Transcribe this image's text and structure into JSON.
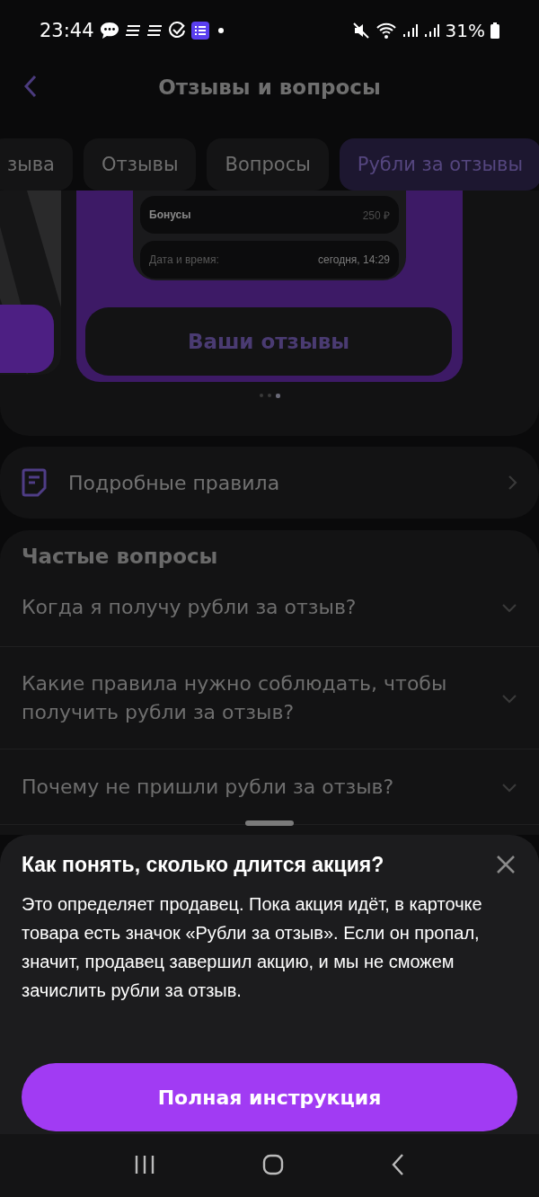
{
  "status_bar": {
    "time": "23:44",
    "battery": "31%"
  },
  "header": {
    "title": "Отзывы и вопросы"
  },
  "tabs": [
    {
      "label": "зыва",
      "selected": false
    },
    {
      "label": "Отзывы",
      "selected": false
    },
    {
      "label": "Вопросы",
      "selected": false
    },
    {
      "label": "Рубли за отзывы",
      "selected": true
    }
  ],
  "carousel": {
    "mockup_rows": [
      {
        "label": "Бонусы",
        "value": "250 ₽",
        "kind": "strong"
      },
      {
        "label": "Дата и время:",
        "value": "сегодня, 14:29",
        "kind": "muted"
      }
    ],
    "button": "Ваши отзывы",
    "dots": [
      {
        "selected": false
      },
      {
        "selected": false
      },
      {
        "selected": true
      }
    ]
  },
  "rules_link": {
    "label": "Подробные правила"
  },
  "faq": {
    "title": "Частые вопросы",
    "items": [
      {
        "question": "Когда я получу рубли за отзыв?",
        "expanded": false
      },
      {
        "question": "Какие правила нужно соблюдать, чтобы получить рубли за отзыв?",
        "expanded": false
      },
      {
        "question": "Почему не пришли рубли за отзыв?",
        "expanded": false
      }
    ]
  },
  "sheet": {
    "title": "Как понять, сколько длится акция?",
    "text": "Это определяет продавец. Пока акция идёт, в карточке товара есть значок «Рубли за отзыв». Если он пропал, значит, продавец завершил акцию, и мы не сможем зачислить рубли за отзыв.",
    "button": "Полная инструкция"
  }
}
